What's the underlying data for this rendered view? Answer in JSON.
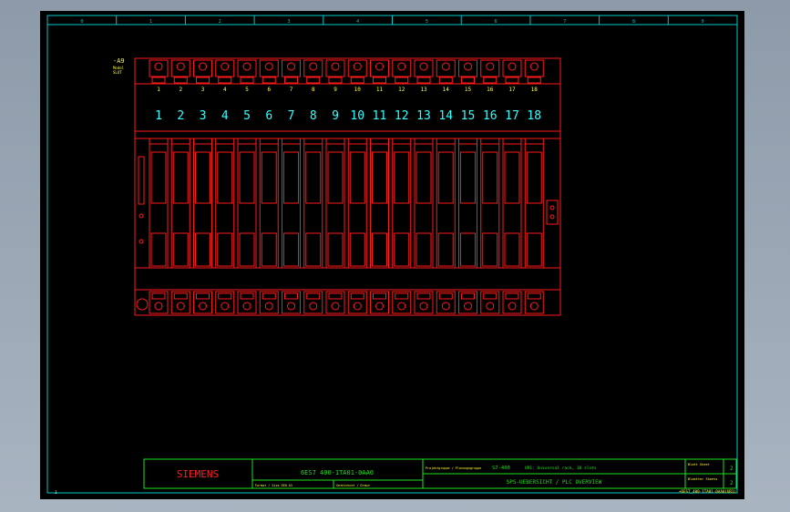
{
  "drawing": {
    "column_numbers": [
      "0",
      "1",
      "2",
      "3",
      "4",
      "5",
      "6",
      "7",
      "8",
      "9"
    ],
    "rack": {
      "tag": "-A9",
      "caption_lines": [
        "Model",
        "SLOT"
      ],
      "slot_labels": [
        "1",
        "2",
        "3",
        "4",
        "5",
        "6",
        "7",
        "8",
        "9",
        "10",
        "11",
        "12",
        "13",
        "14",
        "15",
        "16",
        "17",
        "18"
      ],
      "slot_numbers": [
        "1",
        "2",
        "3",
        "4",
        "5",
        "6",
        "7",
        "8",
        "9",
        "10",
        "11",
        "12",
        "13",
        "14",
        "15",
        "16",
        "17",
        "18"
      ]
    },
    "title_block": {
      "brand": "SIEMENS",
      "part_number": "6ES7 400-1TA01-0AA0",
      "field_format": "Format / Size DIN A3",
      "field_designer": "Gezeichnet / Drawn",
      "field_system": "Projektgruppe / Planungsgruppe",
      "system_name": "S7-400",
      "ur_description": "UR1: Universal rack, 18 slots",
      "title": "SPS-UEBERSICHT / PLC OVERVIEW",
      "sheet_label": "Blatt Sheet",
      "sheet_number": "2",
      "sheets_label": "Blaetter Sheets",
      "sheets_number": "2",
      "file_name": "+6ES7_400-1TA01-0AA0(UR1)"
    },
    "corner_mark": "1"
  },
  "colors": {
    "frame": "#00c8c8",
    "rack": "#ff1a1a",
    "label": "#ffff3a",
    "slot_number": "#33ffff",
    "title_block": "#20e020",
    "brand": "#ff2020"
  }
}
